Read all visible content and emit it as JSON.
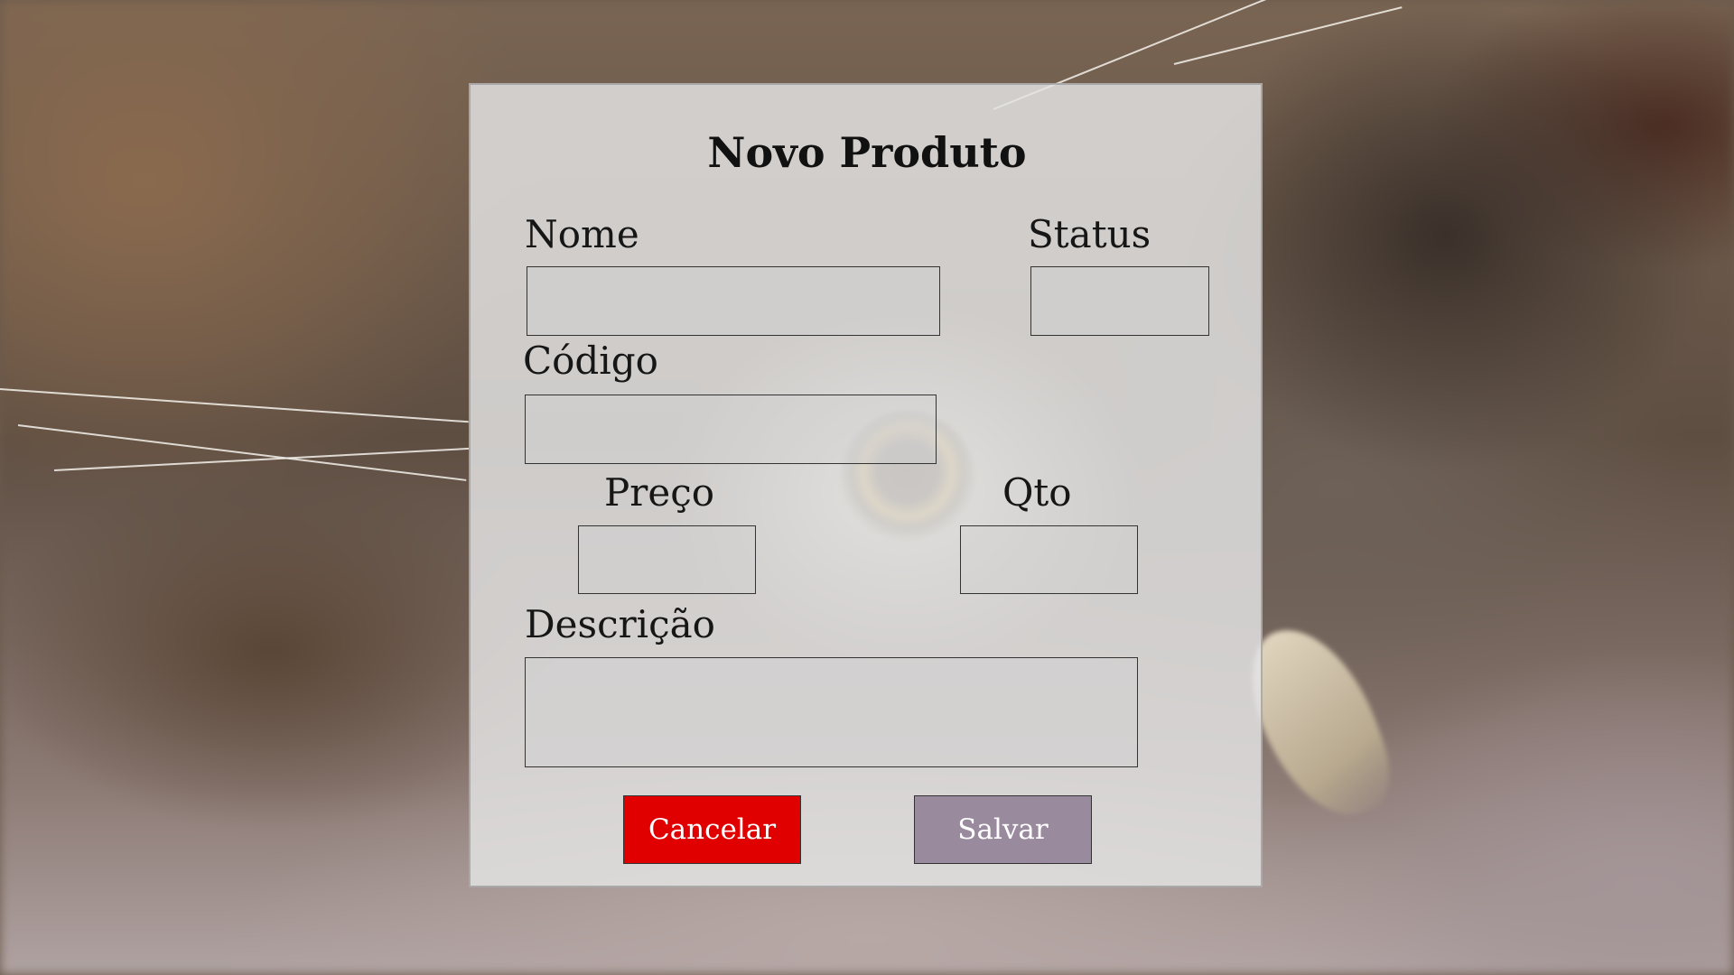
{
  "form": {
    "title": "Novo Produto",
    "fields": {
      "nome": {
        "label": "Nome",
        "value": "",
        "placeholder": ""
      },
      "status": {
        "label": "Status",
        "value": "",
        "placeholder": ""
      },
      "codigo": {
        "label": "Código",
        "value": "",
        "placeholder": ""
      },
      "preco": {
        "label": "Preço",
        "value": "",
        "placeholder": ""
      },
      "qto": {
        "label": "Qto",
        "value": "",
        "placeholder": ""
      },
      "descricao": {
        "label": "Descrição",
        "value": "",
        "placeholder": ""
      }
    },
    "buttons": {
      "cancel_label": "Cancelar",
      "save_label": "Salvar"
    }
  },
  "colors": {
    "cancel_button": "#e00000",
    "save_button": "#9a8a9e",
    "panel_background": "#e4e4e4"
  }
}
